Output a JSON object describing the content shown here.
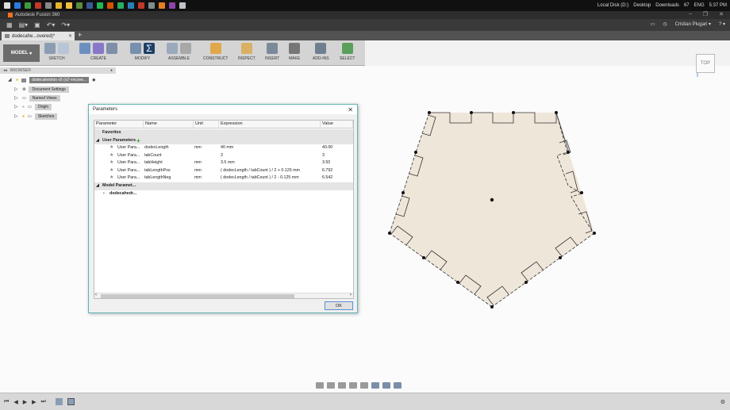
{
  "os_taskbar": {
    "right_items": [
      "Local Disk (D:)",
      "Desktop",
      "Downloads",
      "67",
      "ENG",
      "5:37 PM"
    ]
  },
  "app": {
    "title": "Autodesk Fusion 360"
  },
  "qat": {
    "user_name": "Cristian Plugari"
  },
  "document_tab": {
    "label": "dodecahe...overed)*"
  },
  "ribbon": {
    "workspace": "MODEL",
    "groups": [
      "SKETCH",
      "CREATE",
      "MODIFY",
      "ASSEMBLE",
      "CONSTRUCT",
      "INSPECT",
      "INSERT",
      "MAKE",
      "ADD-INS",
      "SELECT"
    ]
  },
  "browser": {
    "title": "BROWSER",
    "root": "dodecahedron v5 (v2~recove...",
    "items": [
      "Document Settings",
      "Named Views",
      "Origin",
      "Sketches"
    ]
  },
  "viewcube": {
    "label": "TOP"
  },
  "parameters_dialog": {
    "title": "Parameters",
    "columns": [
      "Parameter",
      "Name",
      "Unit",
      "Expression",
      "Value"
    ],
    "favorites_label": "Favorites",
    "user_section_label": "User Parameters",
    "rows": [
      {
        "param": "User Para...",
        "name": "dodecLength",
        "unit": "mm",
        "expression": "40 mm",
        "value": "40.00"
      },
      {
        "param": "User Para...",
        "name": "tabCount",
        "unit": "",
        "expression": "3",
        "value": "3"
      },
      {
        "param": "User Para...",
        "name": "tabHeight",
        "unit": "mm",
        "expression": "3.5 mm",
        "value": "3.50"
      },
      {
        "param": "User Para...",
        "name": "tabLengthPos",
        "unit": "mm",
        "expression": "( dodecLength / tabCount ) / 2 + 0.125 mm",
        "value": "6.792"
      },
      {
        "param": "User Para...",
        "name": "tabLengthNeg",
        "unit": "mm",
        "expression": "( dodecLength / tabCount ) / 2 - 0.125 mm",
        "value": "6.542"
      }
    ],
    "model_section_label": "Model Paramet...",
    "model_child_label": "dodecahedr...",
    "ok_label": "OK"
  }
}
